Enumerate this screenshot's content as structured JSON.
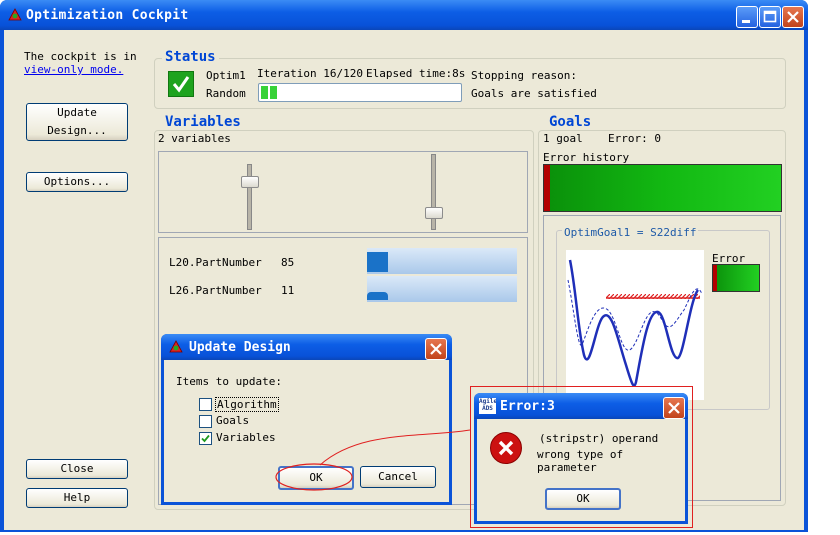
{
  "window": {
    "title": "Optimization Cockpit"
  },
  "left": {
    "view_only_text": "The cockpit is in",
    "view_only_link": "view-only mode.",
    "update_design_btn": "Update Design...",
    "options_btn": "Options...",
    "close_btn": "Close",
    "help_btn": "Help"
  },
  "status": {
    "title": "Status",
    "optim_name": "Optim1",
    "iteration": "Iteration 16/120",
    "elapsed": "Elapsed time:8s",
    "mode": "Random",
    "progress": 0.08,
    "stop_label": "Stopping reason:",
    "stop_reason": "Goals are satisfied"
  },
  "variables": {
    "title": "Variables",
    "count": "2 variables",
    "slider1_value": 0.78,
    "slider2_value": 0.17,
    "params": [
      {
        "label": "L20.PartNumber",
        "value": "85",
        "fill": 0.14
      },
      {
        "label": "L26.PartNumber",
        "value": "11",
        "fill": 0.14
      }
    ]
  },
  "goals": {
    "title": "Goals",
    "count": "1 goal",
    "error": "Error: 0",
    "history_label": "Error history",
    "goal_name": "OptimGoal1 = S22diff",
    "error_label": "Error"
  },
  "update_dialog": {
    "title": "Update Design",
    "items_label": "Items to update:",
    "items": [
      {
        "label": "Algorithm",
        "checked": false
      },
      {
        "label": "Goals",
        "checked": false
      },
      {
        "label": "Variables",
        "checked": true
      }
    ],
    "ok": "OK",
    "cancel": "Cancel"
  },
  "error_dialog": {
    "title": "Error:3",
    "icon_text": "Agilent ADS",
    "line1": "(stripstr) operand",
    "line2": "wrong type of parameter",
    "ok": "OK"
  },
  "colors": {
    "accent": "#0046d5",
    "titlebar": "#0a53d8",
    "face": "#ece9d8",
    "ok_green": "#1ea31e",
    "error_red": "#cc1111"
  }
}
